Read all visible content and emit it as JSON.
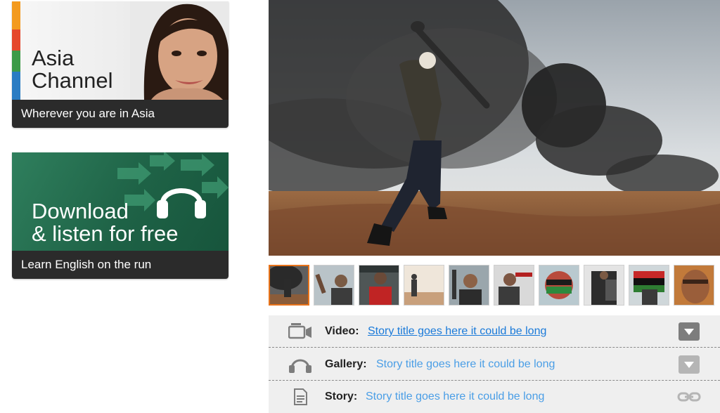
{
  "promos": [
    {
      "title_line1": "Asia",
      "title_line2": "Channel",
      "caption": "Wherever you are in Asia"
    },
    {
      "title_line1": "Download",
      "title_line2": "& listen for free",
      "caption": "Learn English on the run",
      "icon": "headphones-icon"
    }
  ],
  "hero": {
    "description": "photo"
  },
  "thumbnails": {
    "count": 10,
    "selected_index": 0
  },
  "stories": [
    {
      "type": "Video:",
      "title": "Story title goes here it could be long",
      "icon": "video-camera-icon",
      "action": "expand-icon",
      "active": true
    },
    {
      "type": "Gallery:",
      "title": "Story title goes here it could be long",
      "icon": "headphones-icon",
      "action": "expand-icon",
      "active": false
    },
    {
      "type": "Story:",
      "title": "Story title goes here it could be long",
      "icon": "document-icon",
      "action": "link-icon",
      "active": false
    }
  ],
  "colors": {
    "accent": "#e8731a",
    "link": "#4a9ee6",
    "caption_bg": "#2b2b2b",
    "download_green": "#1e6246"
  }
}
